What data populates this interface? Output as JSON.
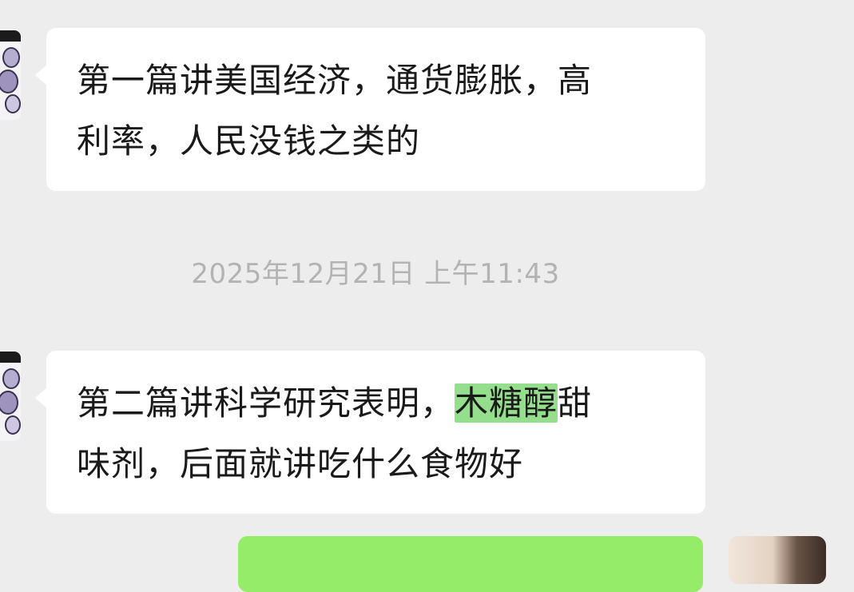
{
  "messages": [
    {
      "sender": "other",
      "line1": "第一篇讲美国经济，通货膨胀，高",
      "line2": "利率，人民没钱之类的"
    },
    {
      "sender": "other",
      "line1_before": "第二篇讲科学研究表明，",
      "line1_highlight": "木糖醇",
      "line1_after": "甜",
      "line2": "味剂，后面就讲吃什么食物好"
    }
  ],
  "timestamp": "2025年12月21日 上午11:43",
  "colors": {
    "background": "#ededed",
    "incoming_bubble": "#ffffff",
    "outgoing_bubble": "#95ec69",
    "highlight": "#95de8e",
    "timestamp_text": "#b3b3b3"
  }
}
